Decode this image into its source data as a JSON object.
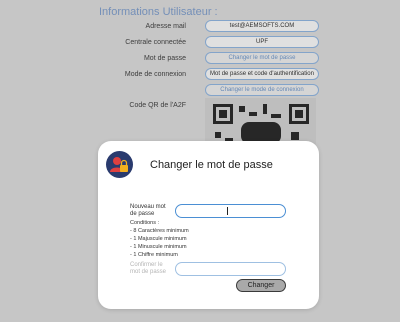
{
  "background": {
    "section_title": "Informations Utilisateur :",
    "rows": [
      {
        "label": "Adresse mail",
        "value": "test@AEMSOFTS.COM"
      },
      {
        "label": "Centrale connectée",
        "value": "UPF"
      },
      {
        "label": "Mot de passe",
        "value": "Changer le mot de passe"
      },
      {
        "label": "Mode de connexion",
        "value": "Mot de passe et code d'authentification"
      },
      {
        "label": "",
        "value": "Changer le mode de connexion"
      },
      {
        "label": "Code QR de l'A2F",
        "value": ""
      }
    ]
  },
  "modal": {
    "title": "Changer le mot de passe",
    "new_password_label": "Nouveau mot de passe",
    "new_password_value": "",
    "conditions_title": "Conditions :",
    "conditions": [
      "- 8 Caractères minimum",
      "- 1 Majuscule minimum",
      "- 1 Minuscule minimum",
      "- 1 Chiffre minimum"
    ],
    "confirm_label": "Confirmer le mot de passe",
    "confirm_value": "",
    "submit_label": "Changer"
  },
  "colors": {
    "accent": "#4b8fd4",
    "title_blue": "#7e9cc8",
    "icon_bg": "#2a3b6e"
  }
}
